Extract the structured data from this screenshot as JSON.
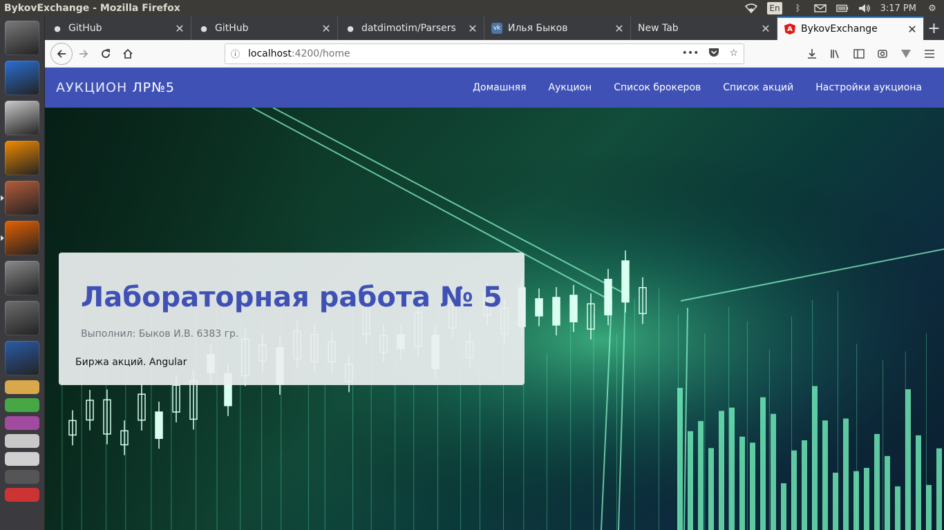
{
  "os": {
    "window_title": "BykovExchange - Mozilla Firefox",
    "keyboard_layout": "En",
    "clock": "3:17 PM"
  },
  "launcher": {
    "items": [
      {
        "name": "ubuntu-dash-icon",
        "color": "#7a7a7a"
      },
      {
        "name": "chromium-icon",
        "color": "#2a6fd4"
      },
      {
        "name": "software-center-icon",
        "color": "#c9c9c9"
      },
      {
        "name": "vlc-icon",
        "color": "#f08a00"
      },
      {
        "name": "file-manager-icon",
        "color": "#b55c3a"
      },
      {
        "name": "firefox-icon",
        "color": "#e66000"
      },
      {
        "name": "system-settings-icon",
        "color": "#8a8a8a"
      },
      {
        "name": "disk-usage-icon",
        "color": "#6e6e6e"
      },
      {
        "name": "libreoffice-writer-icon",
        "color": "#2a5ca8"
      }
    ]
  },
  "browser": {
    "tabs": [
      {
        "label": "GitHub",
        "favicon": "github-icon"
      },
      {
        "label": "GitHub",
        "favicon": "github-icon"
      },
      {
        "label": "datdimotim/Parsers",
        "favicon": "github-icon"
      },
      {
        "label": "Илья Быков",
        "favicon": "vk-icon"
      },
      {
        "label": "New Tab",
        "favicon": ""
      },
      {
        "label": "BykovExchange",
        "favicon": "angular-icon"
      }
    ],
    "new_tab": "+",
    "url_host": "localhost",
    "url_path": ":4200/home"
  },
  "app": {
    "brand_prefix": "АУКЦИОН",
    "brand_suffix": "ЛР№5",
    "menu": [
      "Домашняя",
      "Аукцион",
      "Список брокеров",
      "Список акций",
      "Настройки аукциона"
    ],
    "accent": "#3f51b5"
  },
  "hero": {
    "title": "Лабораторная работа № 5",
    "author": "Выполнил: Быков И.В. 6383 гр.",
    "description": "Биржа акций. Angular"
  }
}
